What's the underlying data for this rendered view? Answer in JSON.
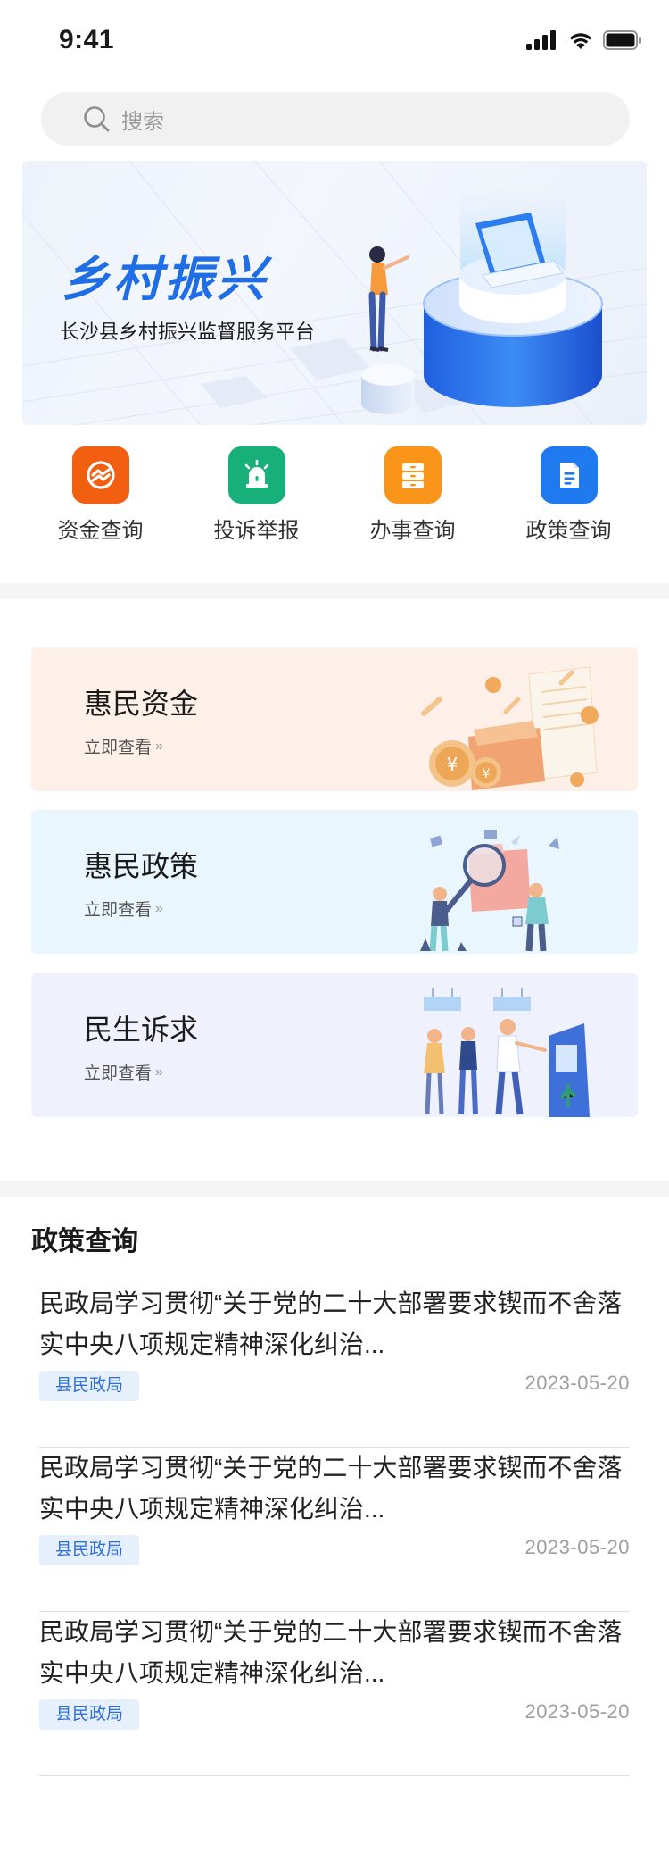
{
  "status_bar": {
    "time": "9:41"
  },
  "search": {
    "placeholder": "搜索"
  },
  "banner": {
    "title": "乡村振兴",
    "subtitle": "长沙县乡村振兴监督服务平台"
  },
  "quick_entries": [
    {
      "label": "资金查询",
      "icon": "fund-query-icon",
      "color": "#f25f10"
    },
    {
      "label": "投诉举报",
      "icon": "alarm-report-icon",
      "color": "#17b07b"
    },
    {
      "label": "办事查询",
      "icon": "cabinet-icon",
      "color": "#fb9519"
    },
    {
      "label": "政策查询",
      "icon": "document-icon",
      "color": "#1f7af0"
    }
  ],
  "cards": [
    {
      "title": "惠民资金",
      "link": "立即查看",
      "bg": "#fdf0e8"
    },
    {
      "title": "惠民政策",
      "link": "立即查看",
      "bg": "#e9f6fd"
    },
    {
      "title": "民生诉求",
      "link": "立即查看",
      "bg": "#eff1fd"
    }
  ],
  "policy": {
    "section_title": "政策查询",
    "items": [
      {
        "title": "民政局学习贯彻“关于党的二十大部署要求锲而不舍落实中央八项规定精神深化纠治...",
        "tag": "县民政局",
        "date": "2023-05-20"
      },
      {
        "title": "民政局学习贯彻“关于党的二十大部署要求锲而不舍落实中央八项规定精神深化纠治...",
        "tag": "县民政局",
        "date": "2023-05-20"
      },
      {
        "title": "民政局学习贯彻“关于党的二十大部署要求锲而不舍落实中央八项规定精神深化纠治...",
        "tag": "县民政局",
        "date": "2023-05-20"
      }
    ]
  }
}
